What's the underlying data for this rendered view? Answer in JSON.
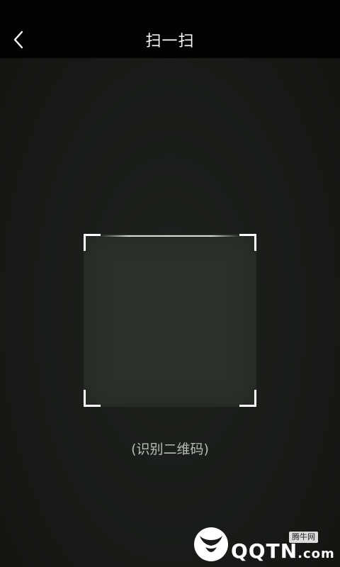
{
  "header": {
    "back_icon": "chevron-left-icon",
    "title": "扫一扫"
  },
  "scanner": {
    "hint": "(识别二维码)"
  },
  "watermark": {
    "site_label": "腾牛网",
    "brand": "QQTN",
    "domain": ".com"
  }
}
